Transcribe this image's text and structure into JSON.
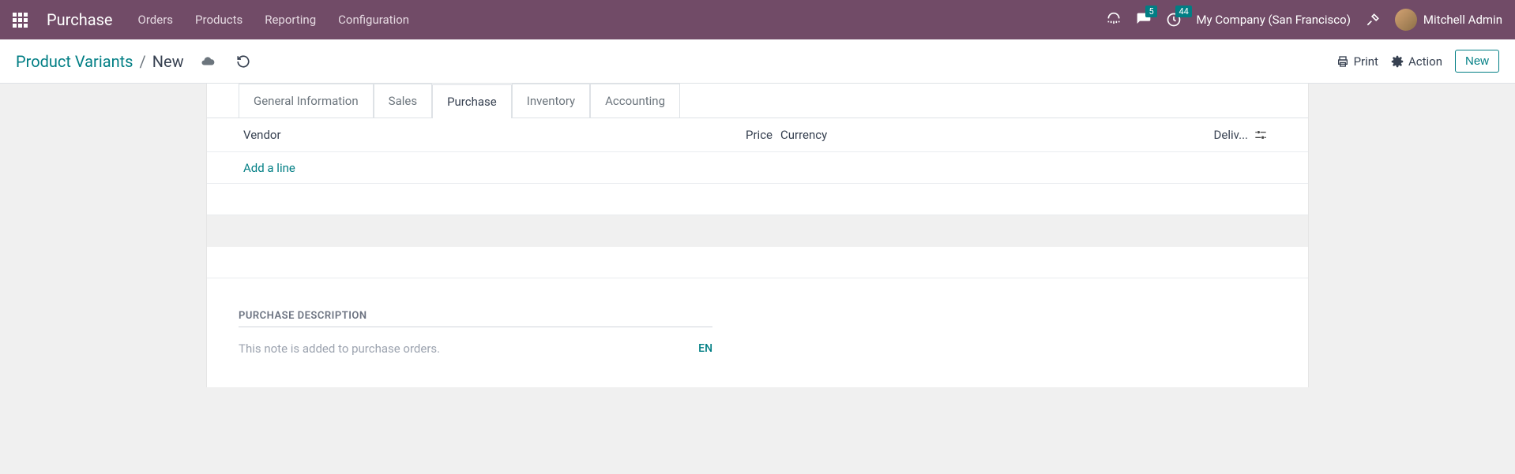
{
  "nav": {
    "app_name": "Purchase",
    "items": [
      "Orders",
      "Products",
      "Reporting",
      "Configuration"
    ],
    "messages_badge": "5",
    "activities_badge": "44",
    "company": "My Company (San Francisco)",
    "user": "Mitchell Admin"
  },
  "breadcrumb": {
    "parent": "Product Variants",
    "current": "New"
  },
  "controls": {
    "print": "Print",
    "action": "Action",
    "new": "New"
  },
  "tabs": {
    "general": "General Information",
    "sales": "Sales",
    "purchase": "Purchase",
    "inventory": "Inventory",
    "accounting": "Accounting"
  },
  "table": {
    "vendor": "Vendor",
    "price": "Price",
    "currency": "Currency",
    "delivery": "Deliv...",
    "add_line": "Add a line"
  },
  "purchase_desc": {
    "title": "PURCHASE DESCRIPTION",
    "placeholder": "This note is added to purchase orders.",
    "lang": "EN"
  }
}
